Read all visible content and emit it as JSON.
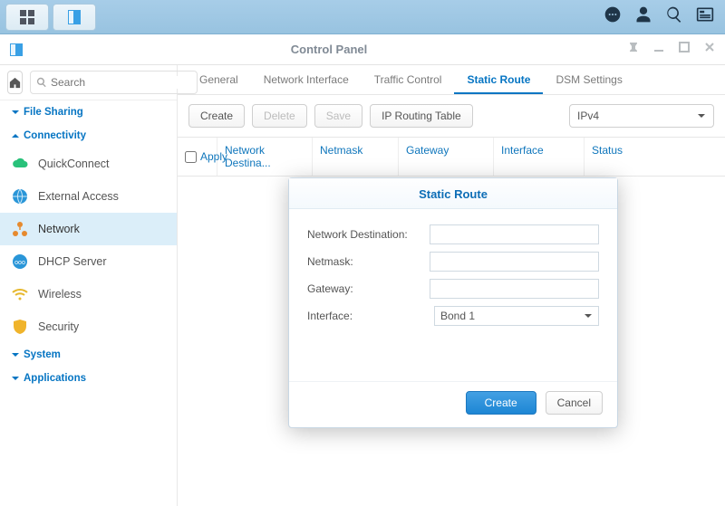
{
  "taskbar": {},
  "window": {
    "title": "Control Panel"
  },
  "search": {
    "placeholder": "Search"
  },
  "sidebar": {
    "sections": {
      "fileSharing": "File Sharing",
      "connectivity": "Connectivity",
      "system": "System",
      "applications": "Applications"
    },
    "items": {
      "quickconnect": "QuickConnect",
      "externalAccess": "External Access",
      "network": "Network",
      "dhcpServer": "DHCP Server",
      "wireless": "Wireless",
      "security": "Security"
    }
  },
  "tabs": {
    "general": "General",
    "networkInterface": "Network Interface",
    "trafficControl": "Traffic Control",
    "staticRoute": "Static Route",
    "dsmSettings": "DSM Settings"
  },
  "toolbar": {
    "create": "Create",
    "delete": "Delete",
    "save": "Save",
    "ipRoutingTable": "IP Routing Table",
    "ipVersion": "IPv4"
  },
  "table": {
    "apply": "Apply",
    "networkDestination": "Network Destina...",
    "netmask": "Netmask",
    "gateway": "Gateway",
    "interface": "Interface",
    "status": "Status"
  },
  "dialog": {
    "title": "Static Route",
    "labels": {
      "networkDestination": "Network Destination:",
      "netmask": "Netmask:",
      "gateway": "Gateway:",
      "interface": "Interface:"
    },
    "values": {
      "networkDestination": "",
      "netmask": "",
      "gateway": "",
      "interfaceSelected": "Bond 1"
    },
    "buttons": {
      "create": "Create",
      "cancel": "Cancel"
    }
  }
}
